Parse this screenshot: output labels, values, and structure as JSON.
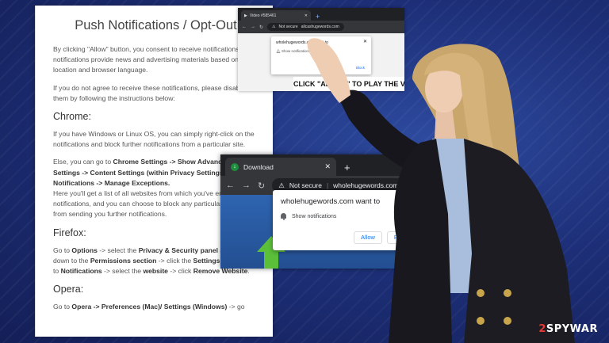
{
  "article": {
    "title": "Push Notifications / Opt-Out",
    "intro": "By clicking \"Allow\" button, you consent to receive notifications. The notifications provide news and advertising materials based on your location and browser language.",
    "intro2": "If you do not agree to receive these notifications, please disable them by following the instructions below:",
    "chrome_heading": "Chrome:",
    "chrome_p1": "If you have Windows or Linux OS, you can simply right-click on the notifications and block further notifications from a particular site.",
    "chrome_p2_a": "Else, you can go to ",
    "chrome_p2_b1": "Chrome Settings -> Show Advanced Settings -> Content Settings (within Privacy Settings) -> Notifications -> Manage Exceptions.",
    "chrome_p2_c": "Here you'll get a list of all websites from which you've enabled notifications, and you can choose to block any particular website from sending you further notifications.",
    "firefox_heading": "Firefox:",
    "firefox_p_a": "Go to ",
    "firefox_p_b1": "Options",
    "firefox_p_c": " -> select the ",
    "firefox_p_b2": "Privacy & Security panel",
    "firefox_p_d": " and scroll down to the ",
    "firefox_p_b3": "Permissions section",
    "firefox_p_e": " -> click the ",
    "firefox_p_b4": "Settings button",
    "firefox_p_f": " next to ",
    "firefox_p_b5": "Notifications",
    "firefox_p_g": " -> select the ",
    "firefox_p_b6": "website",
    "firefox_p_h": " -> click ",
    "firefox_p_b7": "Remove Website",
    "firefox_p_i": ".",
    "opera_heading": "Opera:",
    "opera_p_a": "Go to ",
    "opera_p_b": "Opera -> Preferences (Mac)/ Settings (Windows)",
    "opera_p_c": " -> go"
  },
  "small_browser": {
    "tab_label": "Video #585461",
    "security_label": "Not secure",
    "url": "allcashugewords.com",
    "popup_title": "wholehugewords.com want to",
    "popup_row": "Show notifications",
    "block_label": "Block",
    "banner_text": "CLICK \"ALLOW\" TO PLAY THE V"
  },
  "main_browser": {
    "tab_label": "Download",
    "security_label": "Not secure",
    "url": "wholehugewords.com",
    "popup_title": "wholehugewords.com want to",
    "popup_row": "Show notifications",
    "allow_label": "Allow",
    "block_label": "Block",
    "page_fragment": "A"
  },
  "watermark": {
    "prefix": "2",
    "suffix": "SPYWAR"
  },
  "colors": {
    "background": "#1d2f78",
    "chrome_dark": "#202124",
    "chrome_tab": "#35363a",
    "link_blue": "#1a73e8",
    "arrow_green": "#5bbf3a",
    "watermark_red": "#e53935"
  }
}
